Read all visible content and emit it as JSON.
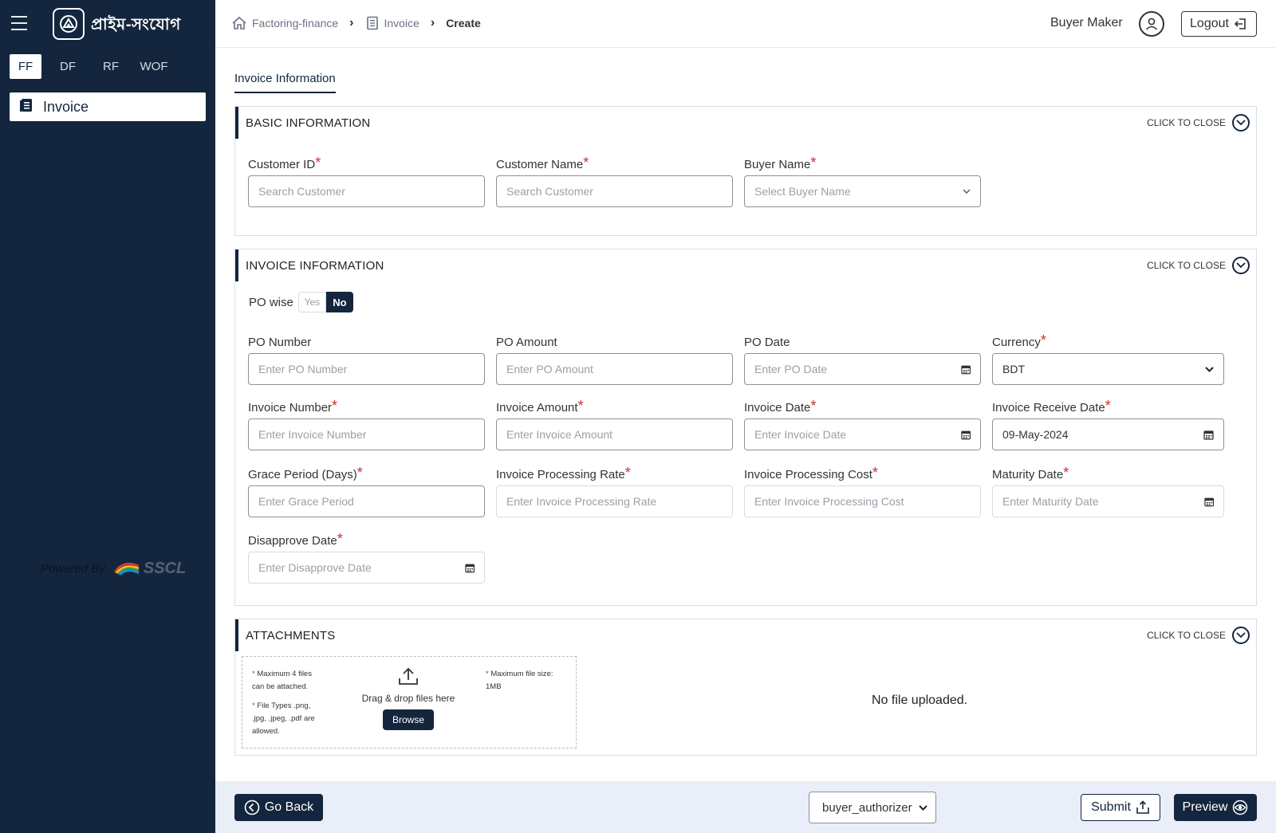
{
  "app": {
    "logo_text": "প্রাইম-সংযোগ",
    "product_tabs": [
      "FF",
      "DF",
      "RF",
      "WOF"
    ],
    "active_product": "FF",
    "nav_items": [
      {
        "label": "Invoice",
        "icon": "document-list-icon"
      }
    ],
    "powered_by": "Powered By",
    "powered_brand": "SSCL"
  },
  "header": {
    "breadcrumb": [
      "Factoring-finance",
      "Invoice",
      "Create"
    ],
    "user_name": "Buyer Maker",
    "logout_label": "Logout"
  },
  "page": {
    "tab_label": "Invoice Information"
  },
  "basic_info": {
    "title": "BASIC INFORMATION",
    "close_label": "CLICK TO CLOSE",
    "customer_id": {
      "label": "Customer ID",
      "placeholder": "Search Customer",
      "required": true
    },
    "customer_name": {
      "label": "Customer Name",
      "placeholder": "Search Customer",
      "required": true
    },
    "buyer_name": {
      "label": "Buyer Name",
      "placeholder": "Select Buyer Name",
      "required": true
    }
  },
  "invoice_info": {
    "title": "INVOICE INFORMATION",
    "close_label": "CLICK TO CLOSE",
    "po_wise": {
      "label": "PO wise",
      "yes": "Yes",
      "no": "No",
      "selected": "No"
    },
    "po_number": {
      "label": "PO Number",
      "placeholder": "Enter PO Number"
    },
    "po_amount": {
      "label": "PO Amount",
      "placeholder": "Enter PO Amount"
    },
    "po_date": {
      "label": "PO Date",
      "placeholder": "Enter PO Date"
    },
    "currency": {
      "label": "Currency",
      "value": "BDT",
      "required": true
    },
    "invoice_number": {
      "label": "Invoice Number",
      "placeholder": "Enter Invoice Number",
      "required": true
    },
    "invoice_amount": {
      "label": "Invoice Amount",
      "placeholder": "Enter Invoice Amount",
      "required": true
    },
    "invoice_date": {
      "label": "Invoice Date",
      "placeholder": "Enter Invoice Date",
      "required": true
    },
    "invoice_receive_date": {
      "label": "Invoice Receive Date",
      "value": "09-May-2024",
      "required": true
    },
    "grace_period": {
      "label": "Grace Period (Days)",
      "placeholder": "Enter Grace Period",
      "required": true
    },
    "processing_rate": {
      "label": "Invoice Processing Rate",
      "placeholder": "Enter Invoice Processing Rate",
      "required": true
    },
    "processing_cost": {
      "label": "Invoice Processing Cost",
      "placeholder": "Enter Invoice Processing Cost",
      "required": true
    },
    "maturity_date": {
      "label": "Maturity Date",
      "placeholder": "Enter Maturity Date",
      "required": true
    },
    "disapprove_date": {
      "label": "Disapprove Date",
      "placeholder": "Enter Disapprove Date",
      "required": true
    }
  },
  "attachments": {
    "title": "ATTACHMENTS",
    "close_label": "CLICK TO CLOSE",
    "note_max_files_1": "Maximum 4 files",
    "note_max_files_2": "can be attached.",
    "note_types_1": "File Types .png,",
    "note_types_2": ".jpg, .jpeg, .pdf are",
    "note_types_3": "allowed.",
    "note_size_1": "Maximum file size:",
    "note_size_2": "1MB",
    "drop_text": "Drag & drop files here",
    "browse_label": "Browse",
    "empty_text": "No file uploaded."
  },
  "footer": {
    "go_back_label": "Go Back",
    "role_value": "buyer_authorizer",
    "submit_label": "Submit",
    "preview_label": "Preview"
  },
  "colors": {
    "sidebar_bg": "#13263d",
    "accent": "#13263d",
    "required": "#d62a2a",
    "footer_bg": "#e9eef8"
  }
}
